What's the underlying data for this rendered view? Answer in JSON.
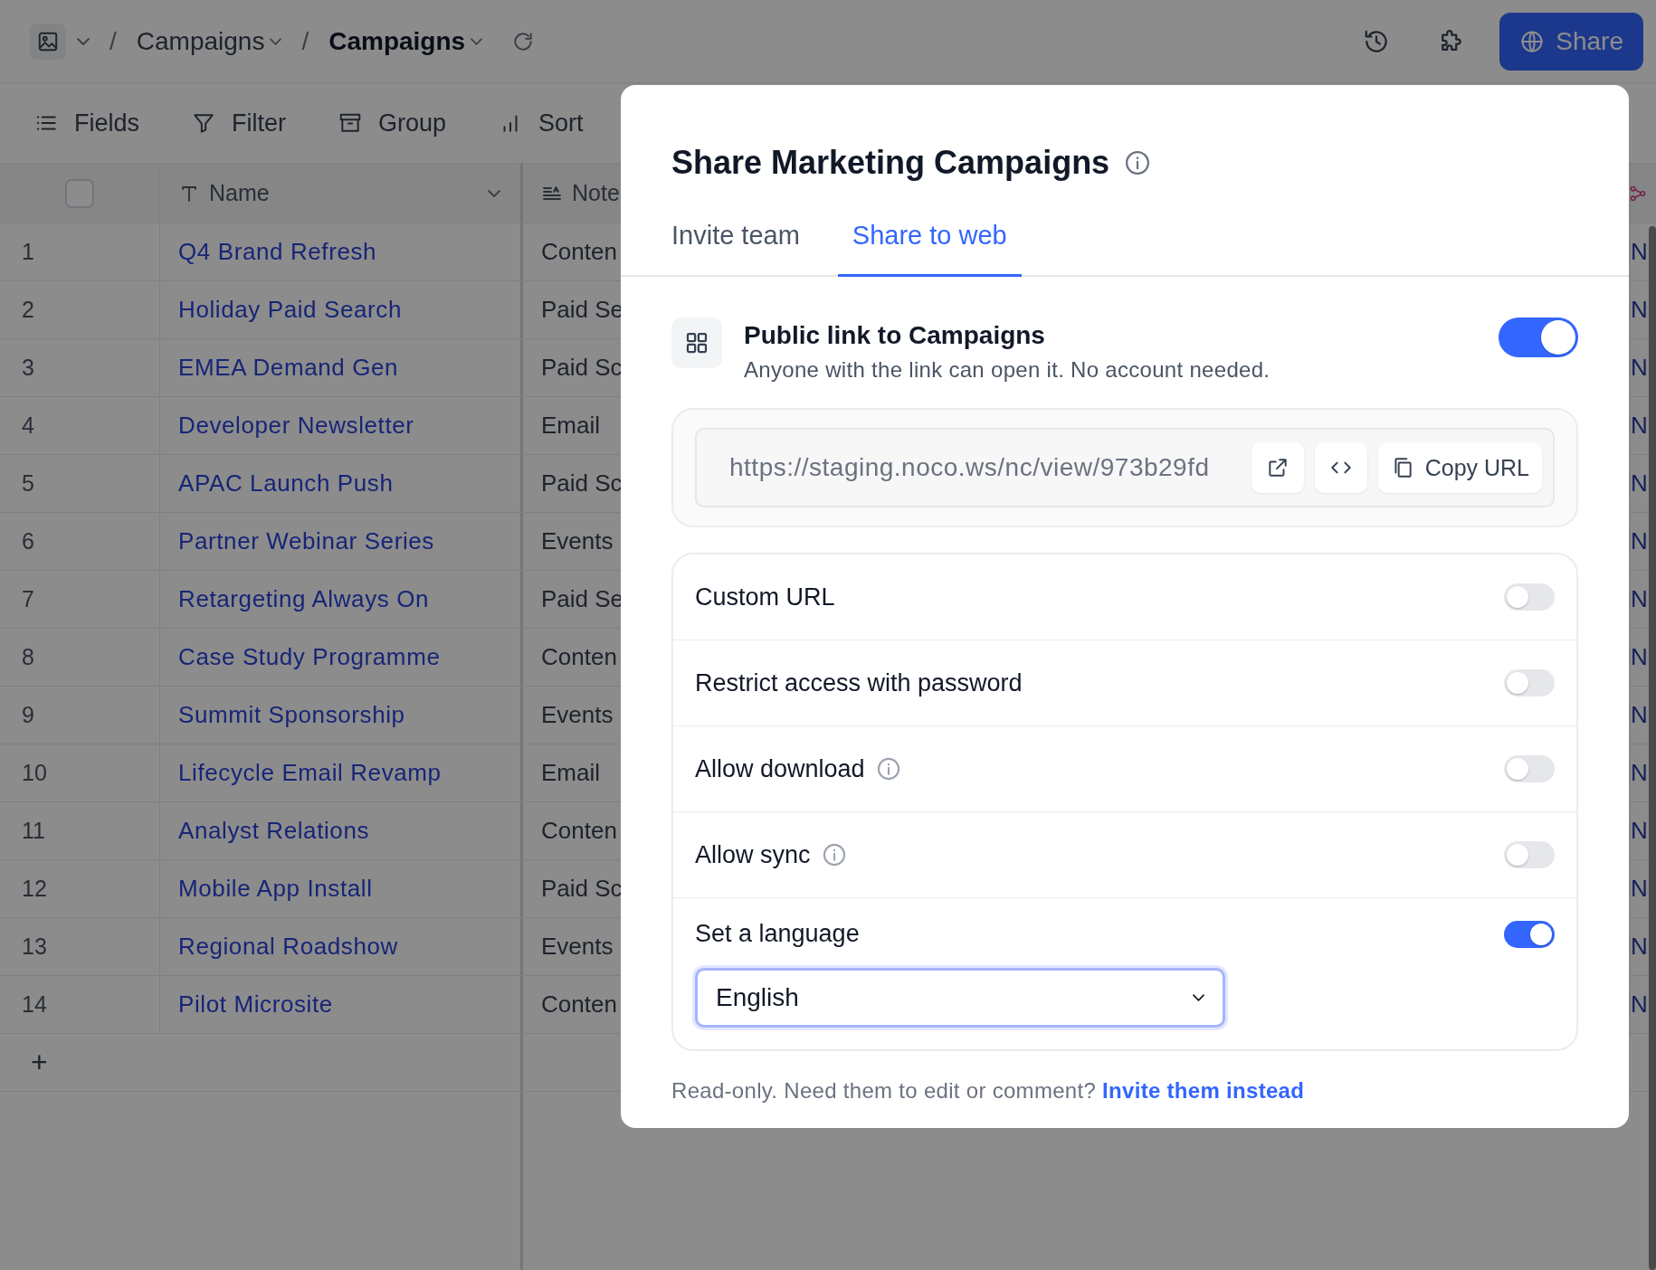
{
  "topbar": {
    "breadcrumbs": [
      {
        "separator": "/",
        "label": "Campaigns",
        "current": false
      },
      {
        "separator": "/",
        "label": "Campaigns",
        "current": true
      }
    ],
    "share_button": "Share"
  },
  "toolbar": [
    {
      "kind": "fields",
      "label": "Fields"
    },
    {
      "kind": "filter",
      "label": "Filter"
    },
    {
      "kind": "group",
      "label": "Group"
    },
    {
      "kind": "sort",
      "label": "Sort"
    }
  ],
  "table": {
    "select_all_checked": false,
    "columns": [
      {
        "kind": "text",
        "label": "Name"
      },
      {
        "kind": "longtext",
        "label": "Note"
      }
    ],
    "rows": [
      {
        "number": "1",
        "name": "Q4 Brand Refresh",
        "column_2": "Conten",
        "column_3": "N"
      },
      {
        "number": "2",
        "name": "Holiday Paid Search",
        "column_2": "Paid Se",
        "column_3": "N"
      },
      {
        "number": "3",
        "name": "EMEA Demand Gen",
        "column_2": "Paid Sc",
        "column_3": "N"
      },
      {
        "number": "4",
        "name": "Developer Newsletter",
        "column_2": "Email",
        "column_3": "N"
      },
      {
        "number": "5",
        "name": "APAC Launch Push",
        "column_2": "Paid Sc",
        "column_3": "N"
      },
      {
        "number": "6",
        "name": "Partner Webinar Series",
        "column_2": "Events",
        "column_3": "N"
      },
      {
        "number": "7",
        "name": "Retargeting Always On",
        "column_2": "Paid Se",
        "column_3": "N"
      },
      {
        "number": "8",
        "name": "Case Study Programme",
        "column_2": "Conten",
        "column_3": "N"
      },
      {
        "number": "9",
        "name": "Summit Sponsorship",
        "column_2": "Events",
        "column_3": "N"
      },
      {
        "number": "10",
        "name": "Lifecycle Email Revamp",
        "column_2": "Email",
        "column_3": "N"
      },
      {
        "number": "11",
        "name": "Analyst Relations",
        "column_2": "Conten",
        "column_3": "N"
      },
      {
        "number": "12",
        "name": "Mobile App Install",
        "column_2": "Paid Sc",
        "column_3": "N"
      },
      {
        "number": "13",
        "name": "Regional Roadshow",
        "column_2": "Events",
        "column_3": "N"
      },
      {
        "number": "14",
        "name": "Pilot Microsite",
        "column_2": "Conten",
        "column_3": "N"
      }
    ],
    "add_row": "+"
  },
  "dialog": {
    "title": "Share Marketing Campaigns",
    "tabs": [
      {
        "label": "Invite team",
        "selected": false
      },
      {
        "label": "Share to web",
        "selected": true
      }
    ],
    "public_link": {
      "title": "Public link to Campaigns",
      "description": "Anyone with the link can open it. No account needed.",
      "on": true
    },
    "url": "https://staging.noco.ws/nc/view/973b29fd",
    "copy_button": "Copy URL",
    "settings": [
      {
        "label": "Custom URL",
        "info": false,
        "on": false
      },
      {
        "label": "Restrict access with password",
        "info": false,
        "on": false
      },
      {
        "label": "Allow download",
        "info": true,
        "on": false
      },
      {
        "label": "Allow sync",
        "info": true,
        "on": false
      }
    ],
    "language": {
      "label": "Set a language",
      "on": true,
      "value": "English"
    },
    "footer": {
      "text": "Read-only. Need them to edit or comment?",
      "link": "Invite them instead"
    }
  }
}
